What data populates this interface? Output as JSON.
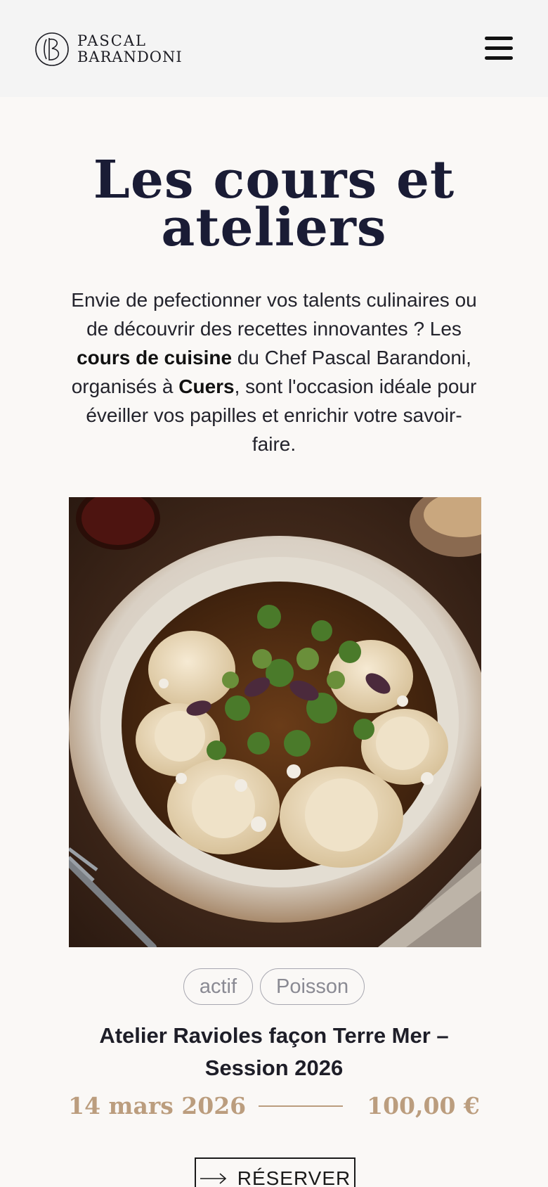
{
  "header": {
    "logo_line1": "PASCAL",
    "logo_line2": "BARANDONI",
    "menu_icon": "hamburger-icon"
  },
  "page": {
    "title_line1": "Les cours et",
    "title_line2": "ateliers",
    "intro": {
      "p1": "Envie de pefectionner vos talents culinaires ou de découvrir des recettes innovantes ? Les ",
      "bold1": "cours de cuisine",
      "p2": " du Chef Pascal Barandoni, organisés à ",
      "bold2": "Cuers",
      "p3": ", sont l'occasion idéale pour éveiller vos papilles et enrichir votre savoir-faire."
    }
  },
  "course": {
    "tags": [
      "actif",
      "Poisson"
    ],
    "title": "Atelier Ravioles façon Terre Mer – Session 2026",
    "date": "14 mars 2026",
    "price": "100,00 €",
    "reserve_label": "RÉSERVER"
  },
  "colors": {
    "accent_gold": "#bb9d7e",
    "title_navy": "#1a1c35",
    "header_bg": "#f4f4f4",
    "page_bg": "#faf8f6"
  }
}
